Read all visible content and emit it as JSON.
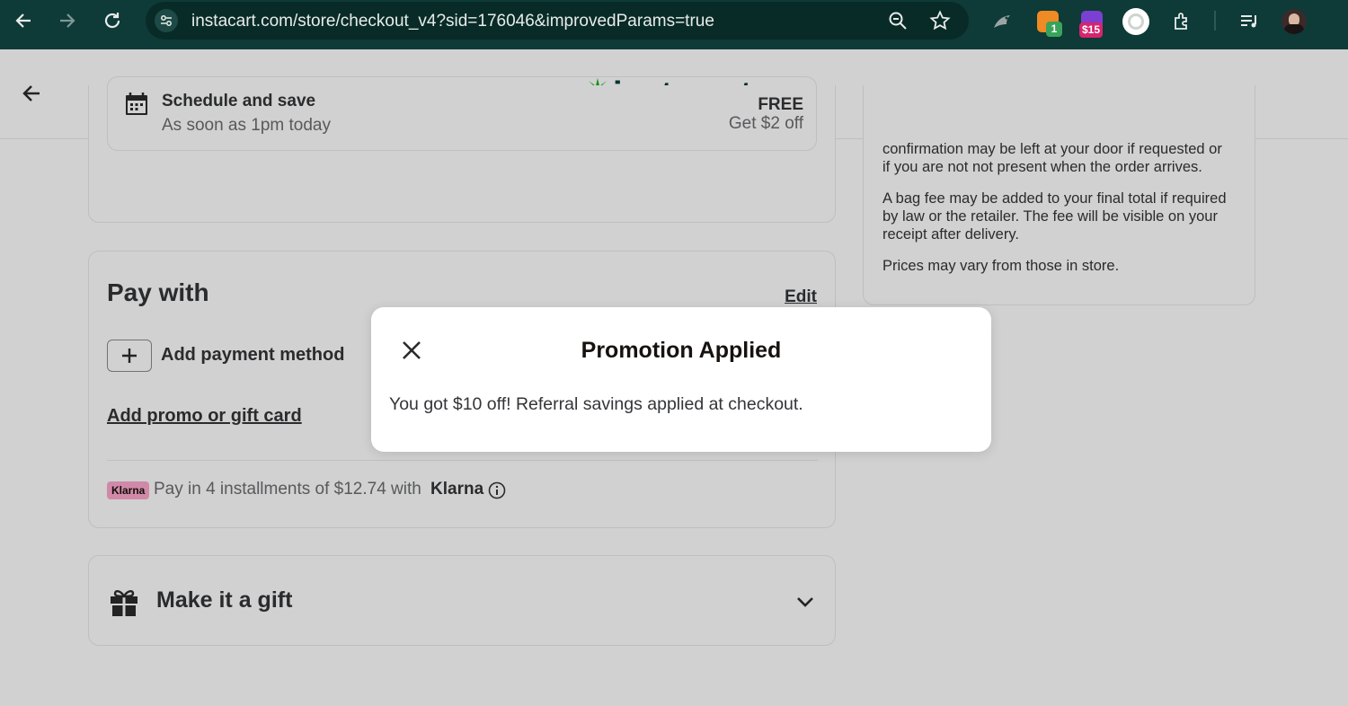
{
  "browser": {
    "url": "instacart.com/store/checkout_v4?sid=176046&improvedParams=true",
    "extensions": [
      {
        "name": "honey-extension-icon",
        "badge": "1",
        "badge_color": "#3aa35b"
      },
      {
        "name": "coupon-extension-icon",
        "badge": "$15",
        "badge_color": "#d6246e"
      }
    ]
  },
  "app": {
    "logo_text": "instacart",
    "brand_color": "#0a3e3a",
    "carrot_color": "#f57c22",
    "leaf_color": "#0aad0a"
  },
  "delivery": {
    "title": "Schedule and save",
    "subtitle": "As soon as 1pm today",
    "price": "FREE",
    "discount": "Get $2 off"
  },
  "pay_with": {
    "title": "Pay with",
    "edit_label": "Edit",
    "add_payment_label": "Add payment method",
    "promo_link": "Add promo or gift card",
    "klarna_badge": "Klarna",
    "klarna_text": "Pay in 4 installments of $12.74 with",
    "klarna_brand": "Klarna"
  },
  "gift": {
    "title": "Make it a gift"
  },
  "notes": {
    "paragraph1": [
      "confirmation may be left at your door if requested or",
      "if you are not not present when the order arrives."
    ],
    "paragraph2": [
      "A bag fee may be added to your final total if required",
      "by law or the retailer. The fee will be visible on your",
      "receipt after delivery."
    ],
    "paragraph3": "Prices may vary from those in store."
  },
  "modal": {
    "title": "Promotion Applied",
    "message": "You got $10 off! Referral savings applied at checkout."
  }
}
